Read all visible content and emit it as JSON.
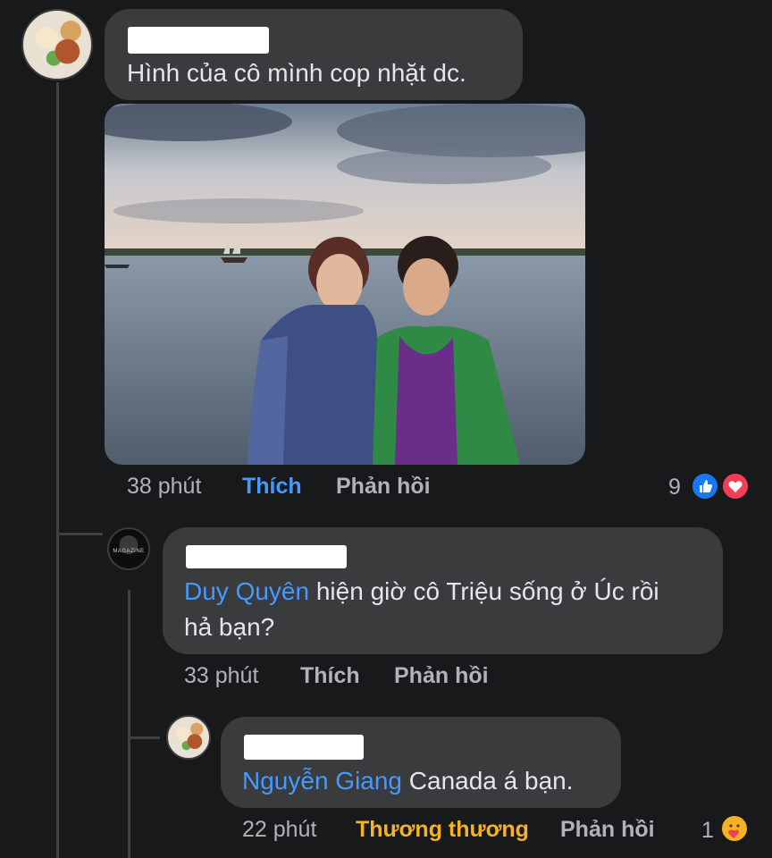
{
  "comments": [
    {
      "text": "Hình của cô mình cop nhặt dc.",
      "meta": {
        "time": "38 phút",
        "like": "Thích",
        "reply": "Phản hồi"
      },
      "reaction_count": "9"
    },
    {
      "mention": "Duy Quyên",
      "text_line1": " hiện giờ cô Triệu sống ở Úc rồi",
      "text_line2": "hả bạn?",
      "meta": {
        "time": "33 phút",
        "like": "Thích",
        "reply": "Phản hồi"
      }
    },
    {
      "mention": "Nguyễn Giang",
      "text": " Canada á bạn.",
      "meta": {
        "time": "22 phút",
        "reaction": "Thương thương",
        "reply": "Phản hồi"
      },
      "reaction_count": "1"
    }
  ],
  "avatar_text": "MAGAZINE",
  "icons": [
    "like-reaction-icon",
    "love-reaction-icon",
    "care-reaction-icon"
  ],
  "colors": {
    "background": "#18191a",
    "bubble": "#3a3b3c",
    "mention": "#4599ff",
    "care": "#f7b125",
    "love": "#f33e58"
  }
}
